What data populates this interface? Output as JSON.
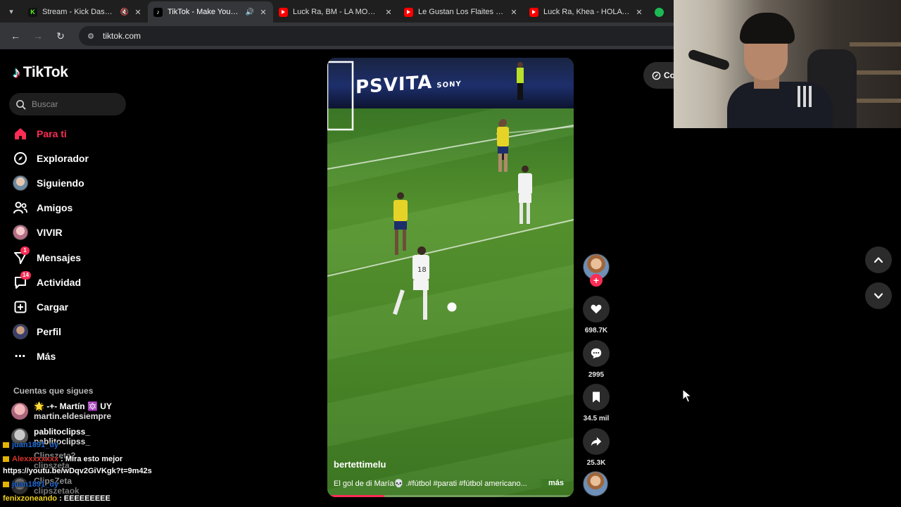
{
  "browser": {
    "tabs": [
      {
        "title": "Stream - Kick Dashboard",
        "favicon": "kick-icon",
        "muted": true,
        "active": false
      },
      {
        "title": "TikTok - Make Your Day",
        "favicon": "tiktok-icon",
        "audio": true,
        "active": true
      },
      {
        "title": "Luck Ra, BM - LA MOROCHA",
        "favicon": "youtube-icon",
        "active": false
      },
      {
        "title": "Le Gustan Los Flaites Guarac",
        "favicon": "youtube-icon",
        "active": false
      },
      {
        "title": "Luck Ra, Khea - HOLA PERDI",
        "favicon": "youtube-icon",
        "active": false
      },
      {
        "title": "P",
        "favicon": "green-icon",
        "active": false
      }
    ],
    "url": "tiktok.com"
  },
  "sidebar": {
    "logo_text": "TikTok",
    "search_placeholder": "Buscar",
    "menu": [
      {
        "label": "Para ti",
        "icon": "home-icon",
        "active": true
      },
      {
        "label": "Explorador",
        "icon": "compass-icon"
      },
      {
        "label": "Siguiendo",
        "icon": "following-avatar-icon"
      },
      {
        "label": "Amigos",
        "icon": "friends-icon"
      },
      {
        "label": "VIVIR",
        "icon": "live-avatar-icon"
      },
      {
        "label": "Mensajes",
        "icon": "messages-icon",
        "badge": "1"
      },
      {
        "label": "Actividad",
        "icon": "activity-icon",
        "badge": "14"
      },
      {
        "label": "Cargar",
        "icon": "upload-icon"
      },
      {
        "label": "Perfil",
        "icon": "profile-avatar-icon"
      },
      {
        "label": "Más",
        "icon": "more-icon"
      }
    ],
    "following_heading": "Cuentas que sigues",
    "following": [
      {
        "name": "🌟 -+- Martín 🔯 UY",
        "username": "martin.eldesiempre"
      },
      {
        "name": "pablitoclipss_",
        "username": "pablitoclipss_"
      },
      {
        "name": "Clipszeta2",
        "username": "clipszeta"
      },
      {
        "name": "ClipsZeta",
        "username": "clipszetaok"
      }
    ]
  },
  "chat": [
    {
      "user": "juan1891_uy",
      "message": ""
    },
    {
      "user": "Alexxxxxxxx",
      "message": "Mira esto mejor"
    },
    {
      "user": "",
      "message": "https://youtu.be/wDqv2GiVKgk?t=9m42s"
    },
    {
      "user": "juan1891_uy",
      "message": ""
    },
    {
      "user": "fenixzoneando",
      "message": "EEEEEEEEE"
    }
  ],
  "video": {
    "username": "bertettimelu",
    "description": "El gol de di María💀 .#fútbol #parati #fútbol americano...",
    "more_label": "más",
    "board_text": "PSVITA",
    "board_brand": "SONY",
    "progress": 0.23
  },
  "actions": {
    "likes": "698.7K",
    "comments": "2995",
    "saves": "34.5 mil",
    "shares": "25.3K"
  },
  "top_right_pill": "Co",
  "colors": {
    "accent": "#fe2c55",
    "background": "#000000",
    "tab_bar": "#1f1f1f",
    "toolbar": "#35363a"
  }
}
